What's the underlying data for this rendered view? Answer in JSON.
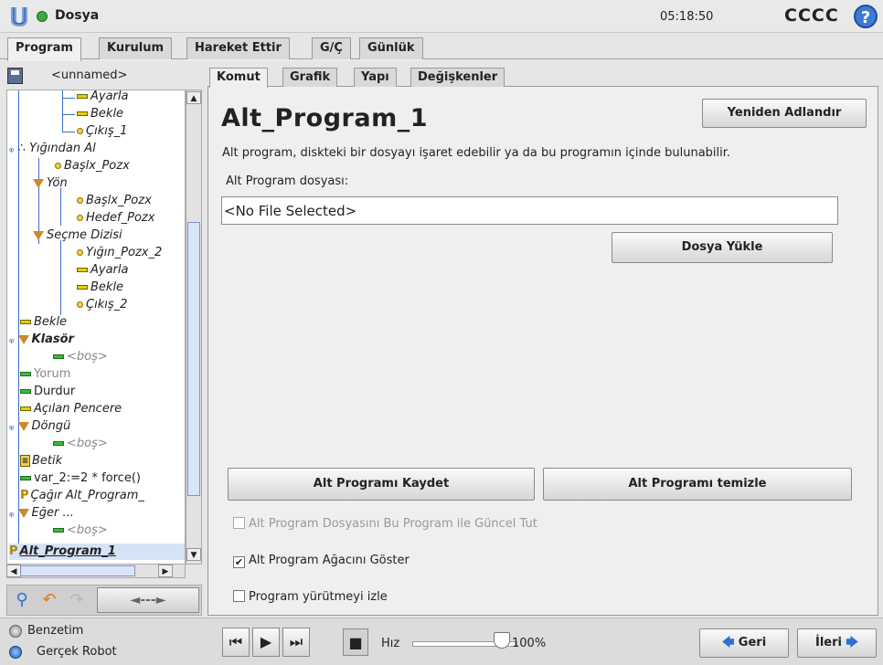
{
  "header": {
    "app_title": "Dosya",
    "clock": "05:18:50",
    "robot_name": "CCCC",
    "help": "?"
  },
  "main_tabs": [
    {
      "label": "Program",
      "active": true
    },
    {
      "label": "Kurulum",
      "active": false
    },
    {
      "label": "Hareket Ettir",
      "active": false
    },
    {
      "label": "G/Ç",
      "active": false
    },
    {
      "label": "Günlük",
      "active": false
    }
  ],
  "left": {
    "program_name": "<unnamed>",
    "tree": [
      {
        "label": "Ayarla"
      },
      {
        "label": "Bekle"
      },
      {
        "label": "Çıkış_1"
      },
      {
        "label": "Yığından Al"
      },
      {
        "label": "Başlx_Pozx"
      },
      {
        "label": "Yön"
      },
      {
        "label": "Başlx_Pozx"
      },
      {
        "label": "Hedef_Pozx"
      },
      {
        "label": "Seçme Dizisi"
      },
      {
        "label": "Yığın_Pozx_2"
      },
      {
        "label": "Ayarla"
      },
      {
        "label": "Bekle"
      },
      {
        "label": "Çıkış_2"
      },
      {
        "label": "Bekle"
      },
      {
        "label": "Klasör"
      },
      {
        "label": "<boş>"
      },
      {
        "label": "Yorum"
      },
      {
        "label": "Durdur"
      },
      {
        "label": "Açılan Pencere"
      },
      {
        "label": "Döngü"
      },
      {
        "label": "<boş>"
      },
      {
        "label": "Betik"
      },
      {
        "label": "var_2:=2 * force()"
      },
      {
        "label": "Çağır Alt_Program_"
      },
      {
        "label": "Eğer ..."
      },
      {
        "label": "<boş>"
      },
      {
        "label": "Alt_Program_1"
      }
    ],
    "nav_arrow": "◄---►"
  },
  "sub_tabs": [
    {
      "label": "Komut",
      "active": true
    },
    {
      "label": "Grafik",
      "active": false
    },
    {
      "label": "Yapı",
      "active": false
    },
    {
      "label": "Değişkenler",
      "active": false
    }
  ],
  "main": {
    "title": "Alt_Program_1",
    "rename_button": "Yeniden Adlandır",
    "description": "Alt program, diskteki bir dosyayı işaret edebilir ya da bu programın içinde bulunabilir.",
    "file_label": "Alt Program dosyası:",
    "file_value": "<No File Selected>",
    "load_button": "Dosya Yükle",
    "save_button": "Alt Programı Kaydet",
    "clear_button": "Alt Programı temizle",
    "checks": [
      {
        "label": "Alt Program Dosyasını Bu Program ile Güncel Tut",
        "checked": false,
        "enabled": false
      },
      {
        "label": "Alt Program Ağacını Göster",
        "checked": true,
        "enabled": true
      },
      {
        "label": "Program yürütmeyi izle",
        "checked": false,
        "enabled": true
      }
    ]
  },
  "footer": {
    "simulation_label": "Benzetim",
    "real_robot_label": "Gerçek Robot",
    "speed_label": "Hız",
    "speed_value": "100%",
    "speed_fraction": 1.0,
    "back_button": "Geri",
    "next_button": "İleri"
  }
}
